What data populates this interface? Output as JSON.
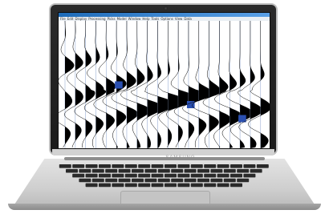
{
  "window": {
    "menu": [
      "File",
      "Edit",
      "Display",
      "Processing",
      "Picks",
      "Model",
      "Window",
      "Help",
      "Tools",
      "Options",
      "View",
      "Data"
    ]
  },
  "device": {
    "brand": "SAMSUNG"
  },
  "seismic": {
    "trace_count": 20,
    "fill_color": "#000000",
    "highlight_color": "#2a4fb0",
    "grid_color": "#9bb0d6"
  }
}
